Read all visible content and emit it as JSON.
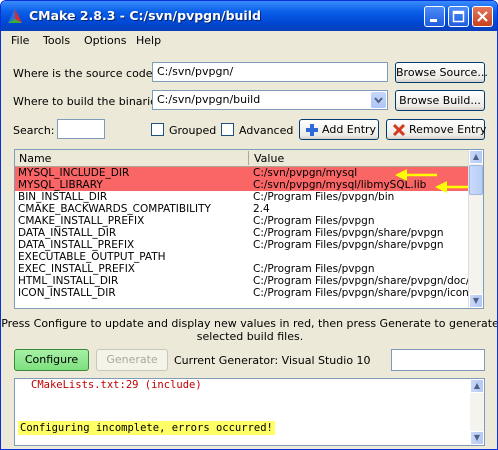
{
  "window": {
    "title": "CMake 2.8.3 - C:/svn/pvpgn/build"
  },
  "menu": {
    "items": [
      "File",
      "Tools",
      "Options",
      "Help"
    ]
  },
  "source": {
    "label": "Where is the source code:",
    "value": "C:/svn/pvpgn/",
    "button": "Browse Source..."
  },
  "binaries": {
    "label": "Where to build the binaries:",
    "value": "C:/svn/pvpgn/build",
    "button": "Browse Build..."
  },
  "search": {
    "label": "Search:",
    "value": ""
  },
  "options": {
    "grouped": "Grouped",
    "advanced": "Advanced",
    "add_entry": "Add Entry",
    "remove_entry": "Remove Entry"
  },
  "table": {
    "columns": [
      "Name",
      "Value"
    ],
    "rows": [
      {
        "name": "MYSQL_INCLUDE_DIR",
        "value": "C:/svn/pvpgn/mysql",
        "highlight": true
      },
      {
        "name": "MYSQL_LIBRARY",
        "value": "C:/svn/pvpgn/mysql/libmySQL.lib",
        "highlight": true
      },
      {
        "name": "BIN_INSTALL_DIR",
        "value": "C:/Program Files/pvpgn/bin",
        "highlight": false
      },
      {
        "name": "CMAKE_BACKWARDS_COMPATIBILITY",
        "value": "2.4",
        "highlight": false
      },
      {
        "name": "CMAKE_INSTALL_PREFIX",
        "value": "C:/Program Files/pvpgn",
        "highlight": false
      },
      {
        "name": "DATA_INSTALL_DIR",
        "value": "C:/Program Files/pvpgn/share/pvpgn",
        "highlight": false
      },
      {
        "name": "DATA_INSTALL_PREFIX",
        "value": "C:/Program Files/pvpgn/share/pvpgn",
        "highlight": false
      },
      {
        "name": "EXECUTABLE_OUTPUT_PATH",
        "value": "",
        "highlight": false
      },
      {
        "name": "EXEC_INSTALL_PREFIX",
        "value": "C:/Program Files/pvpgn",
        "highlight": false
      },
      {
        "name": "HTML_INSTALL_DIR",
        "value": "C:/Program Files/pvpgn/share/pvpgn/doc/...",
        "highlight": false
      },
      {
        "name": "ICON_INSTALL_DIR",
        "value": "C:/Program Files/pvpgn/share/pvpgn/icons...",
        "highlight": false
      }
    ]
  },
  "message": {
    "line1": "Press Configure to update and display new values in red, then press Generate to generate",
    "line2": "selected build files."
  },
  "actions": {
    "configure": "Configure",
    "generate": "Generate",
    "generator_label": "Current Generator: Visual Studio 10"
  },
  "log": {
    "line1": "CMakeLists.txt:29 (include)",
    "line2": "Configuring incomplete, errors occurred!"
  },
  "colors": {
    "highlight_row": "#fa6566",
    "arrow": "#ffff00",
    "configure_button": "#7ee07e",
    "log_error": "#c00000"
  }
}
